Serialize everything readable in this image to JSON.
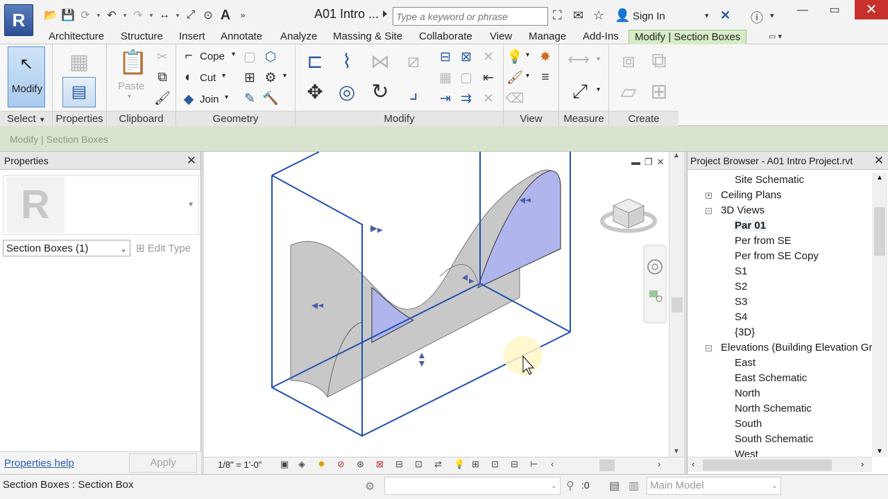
{
  "app": {
    "logo": "R",
    "document_title": "A01 Intro ..."
  },
  "search": {
    "placeholder": "Type a keyword or phrase"
  },
  "account": {
    "signin_label": "Sign In"
  },
  "tabs": [
    {
      "label": "Architecture"
    },
    {
      "label": "Structure"
    },
    {
      "label": "Insert"
    },
    {
      "label": "Annotate"
    },
    {
      "label": "Analyze"
    },
    {
      "label": "Massing & Site"
    },
    {
      "label": "Collaborate"
    },
    {
      "label": "View"
    },
    {
      "label": "Manage"
    },
    {
      "label": "Add-Ins"
    },
    {
      "label": "Modify | Section Boxes"
    }
  ],
  "ribbon": {
    "modify_label": "Modify",
    "select_label": "Select",
    "properties_label": "Properties",
    "paste_label": "Paste",
    "cope_label": "Cope",
    "cut_label": "Cut",
    "join_label": "Join",
    "panels": {
      "clipboard": "Clipboard",
      "geometry": "Geometry",
      "modify": "Modify",
      "view": "View",
      "measure": "Measure",
      "create": "Create"
    }
  },
  "context_bar": {
    "label": "Modify | Section Boxes"
  },
  "properties": {
    "title": "Properties",
    "selector_value": "Section Boxes (1)",
    "edit_type_label": "Edit Type",
    "help_link": "Properties help",
    "apply_label": "Apply"
  },
  "view": {
    "scale": "1/8\" = 1'-0\""
  },
  "browser": {
    "title": "Project Browser - A01 Intro Project.rvt",
    "items": [
      {
        "label": "Site Schematic"
      },
      {
        "label": "Ceiling Plans"
      },
      {
        "label": "3D Views"
      },
      {
        "label": "Par 01"
      },
      {
        "label": "Per from SE"
      },
      {
        "label": "Per from SE Copy"
      },
      {
        "label": "S1"
      },
      {
        "label": "S2"
      },
      {
        "label": "S3"
      },
      {
        "label": "S4"
      },
      {
        "label": "{3D}"
      },
      {
        "label": "Elevations (Building Elevation Gr"
      },
      {
        "label": "East"
      },
      {
        "label": "East Schematic"
      },
      {
        "label": "North"
      },
      {
        "label": "North Schematic"
      },
      {
        "label": "South"
      },
      {
        "label": "South Schematic"
      },
      {
        "label": "West"
      }
    ]
  },
  "status": {
    "text": "Section Boxes : Section Box",
    "filter_count": ":0",
    "model_label": "Main Model"
  },
  "colors": {
    "accent_blue": "#2d5c9e",
    "section_box_blue": "#1f4fb0",
    "modify_tab_green": "#d6ecc6",
    "context_bar_green": "#d8e4cf",
    "close_red": "#c7302b"
  }
}
